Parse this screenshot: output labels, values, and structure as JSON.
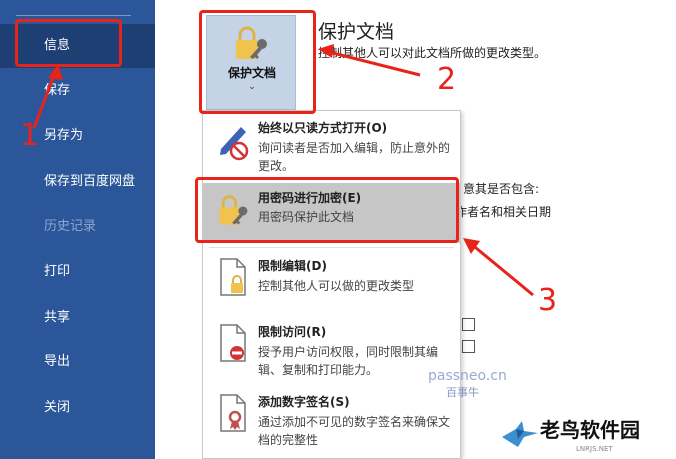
{
  "sidebar": {
    "items": [
      {
        "label": "信息"
      },
      {
        "label": "保存"
      },
      {
        "label": "另存为"
      },
      {
        "label": "保存到百度网盘"
      },
      {
        "label": "历史记录"
      },
      {
        "label": "打印"
      },
      {
        "label": "共享"
      },
      {
        "label": "导出"
      },
      {
        "label": "关闭"
      }
    ]
  },
  "protect": {
    "button_label": "保护文档",
    "chevron": "⌄",
    "title": "保护文档",
    "description": "控制其他人可以对此文档所做的更改类型。"
  },
  "background": {
    "frag1": "意其是否包含:",
    "frag2": "作者名和相关日期"
  },
  "dropdown": {
    "items": [
      {
        "title": "始终以只读方式打开(O)",
        "desc": "询问读者是否加入编辑，防止意外的更改。"
      },
      {
        "title": "用密码进行加密(E)",
        "desc": "用密码保护此文档"
      },
      {
        "title": "限制编辑(D)",
        "desc": "控制其他人可以做的更改类型"
      },
      {
        "title": "限制访问(R)",
        "desc": "授予用户访问权限，同时限制其编辑、复制和打印能力。"
      },
      {
        "title": "添加数字签名(S)",
        "desc": "通过添加不可见的数字签名来确保文档的完整性"
      }
    ]
  },
  "annotations": {
    "n1": "1",
    "n2": "2",
    "n3": "3"
  },
  "watermark": {
    "site": "passneo.cn",
    "name": "百事牛",
    "logo": "老鸟软件园",
    "logo_sub": "LNRJS.NET"
  },
  "colors": {
    "sidebar": "#2b579a",
    "sidebar_active": "#1e3f73",
    "annotation_red": "#e8231a",
    "highlight": "#c6c6c6"
  }
}
